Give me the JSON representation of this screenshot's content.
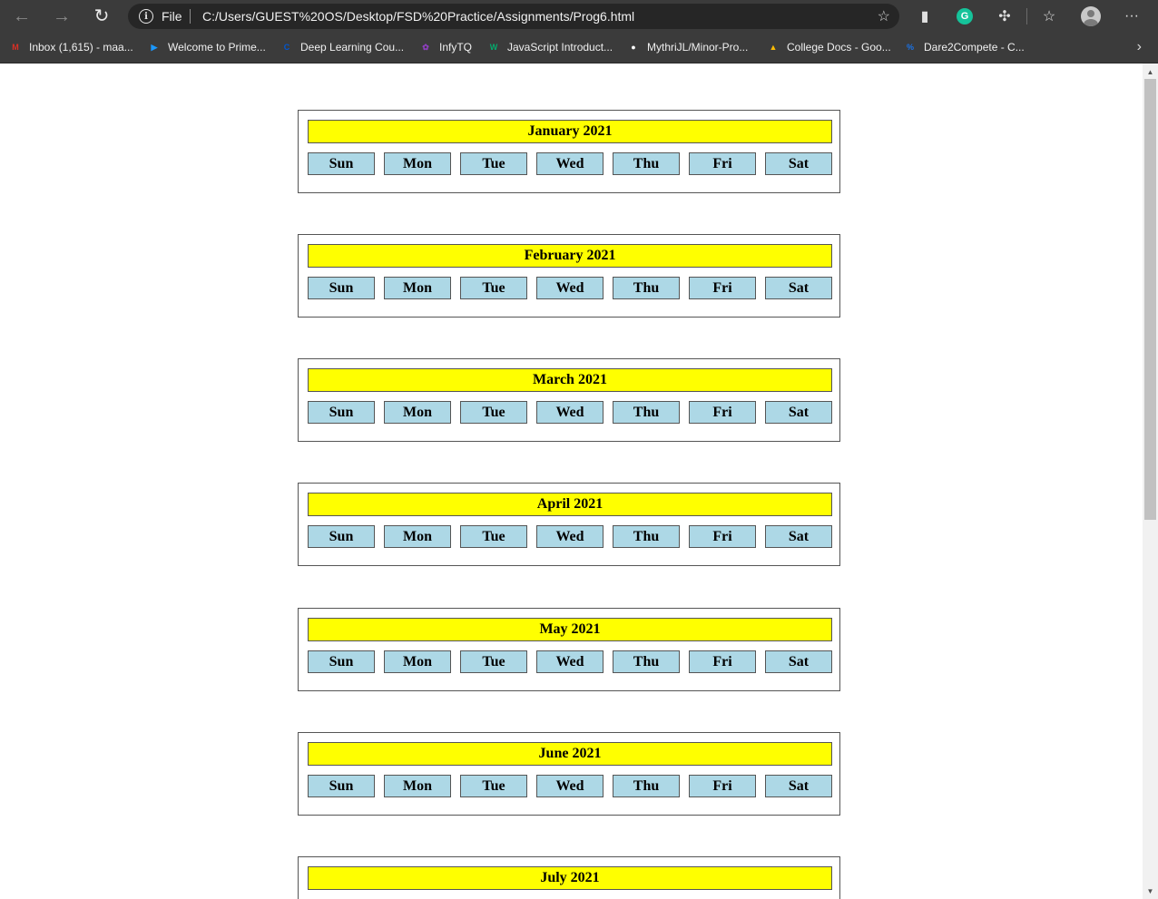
{
  "browser": {
    "file_label": "File",
    "url": "C:/Users/GUEST%20OS/Desktop/FSD%20Practice/Assignments/Prog6.html",
    "grammarly_letter": "G",
    "menu_label": "···"
  },
  "bookmarks": [
    {
      "label": "Inbox (1,615) - maa...",
      "icon": "gmail-icon",
      "color": "#d93025",
      "glyph": "M"
    },
    {
      "label": "Welcome to Prime...",
      "icon": "prime-video-icon",
      "color": "#1a98ff",
      "glyph": "▶"
    },
    {
      "label": "Deep Learning  Cou...",
      "icon": "coursera-icon",
      "color": "#0056d2",
      "glyph": "C"
    },
    {
      "label": "InfyTQ",
      "icon": "infytq-icon",
      "color": "#8e3fbf",
      "glyph": "✿"
    },
    {
      "label": "JavaScript Introduct...",
      "icon": "w3schools-icon",
      "color": "#04aa6d",
      "glyph": "W"
    },
    {
      "label": "MythriJL/Minor-Pro...",
      "icon": "github-icon",
      "color": "#ffffff",
      "glyph": "●"
    },
    {
      "label": "College Docs - Goo...",
      "icon": "google-drive-icon",
      "color": "#fbbc04",
      "glyph": "▲"
    },
    {
      "label": "Dare2Compete - C...",
      "icon": "dare2compete-icon",
      "color": "#1a73e8",
      "glyph": "%"
    }
  ],
  "calendar": {
    "days": [
      "Sun",
      "Mon",
      "Tue",
      "Wed",
      "Thu",
      "Fri",
      "Sat"
    ],
    "months": [
      "January 2021",
      "February 2021",
      "March 2021",
      "April 2021",
      "May 2021",
      "June 2021",
      "July 2021"
    ]
  },
  "colors": {
    "title_bg": "#ffff00",
    "day_bg": "#add8e6"
  }
}
